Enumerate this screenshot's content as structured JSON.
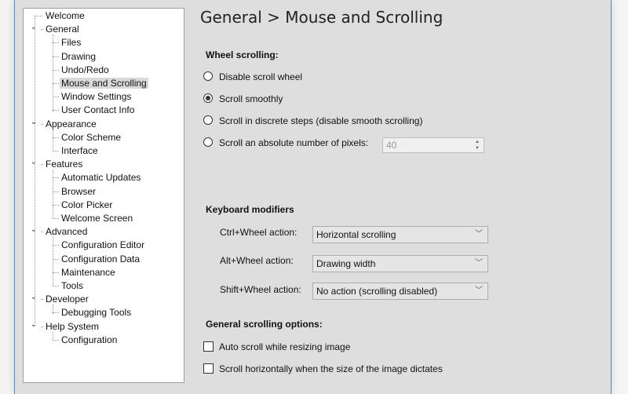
{
  "tree": {
    "items": [
      {
        "label": "Welcome",
        "level": 0,
        "expandable": false
      },
      {
        "label": "General",
        "level": 0,
        "expandable": true
      },
      {
        "label": "Files",
        "level": 1
      },
      {
        "label": "Drawing",
        "level": 1
      },
      {
        "label": "Undo/Redo",
        "level": 1
      },
      {
        "label": "Mouse and Scrolling",
        "level": 1,
        "selected": true
      },
      {
        "label": "Window Settings",
        "level": 1
      },
      {
        "label": "User Contact Info",
        "level": 1
      },
      {
        "label": "Appearance",
        "level": 0,
        "expandable": true
      },
      {
        "label": "Color Scheme",
        "level": 1
      },
      {
        "label": "Interface",
        "level": 1
      },
      {
        "label": "Features",
        "level": 0,
        "expandable": true
      },
      {
        "label": "Automatic Updates",
        "level": 1
      },
      {
        "label": "Browser",
        "level": 1
      },
      {
        "label": "Color Picker",
        "level": 1
      },
      {
        "label": "Welcome Screen",
        "level": 1
      },
      {
        "label": "Advanced",
        "level": 0,
        "expandable": true
      },
      {
        "label": "Configuration Editor",
        "level": 1
      },
      {
        "label": "Configuration Data",
        "level": 1
      },
      {
        "label": "Maintenance",
        "level": 1
      },
      {
        "label": "Tools",
        "level": 1
      },
      {
        "label": "Developer",
        "level": 0,
        "expandable": true
      },
      {
        "label": "Debugging Tools",
        "level": 1
      },
      {
        "label": "Help System",
        "level": 0,
        "expandable": true
      },
      {
        "label": "Configuration",
        "level": 1
      }
    ],
    "chevron_icon": "⌄"
  },
  "main": {
    "title": "General > Mouse and Scrolling",
    "wheel": {
      "heading": "Wheel scrolling:",
      "options": [
        {
          "label": "Disable scroll wheel",
          "checked": false
        },
        {
          "label": "Scroll smoothly",
          "checked": true
        },
        {
          "label": "Scroll in discrete steps (disable smooth scrolling)",
          "checked": false
        },
        {
          "label": "Scroll an absolute number of pixels:",
          "checked": false
        }
      ],
      "pixels_value": "40",
      "spin_up": "▲",
      "spin_down": "▼"
    },
    "keyboard": {
      "heading": "Keyboard modifiers",
      "rows": [
        {
          "label": "Ctrl+Wheel action:",
          "value": "Horizontal scrolling"
        },
        {
          "label": "Alt+Wheel action:",
          "value": "Drawing width"
        },
        {
          "label": "Shift+Wheel action:",
          "value": "No action (scrolling disabled)"
        }
      ],
      "chevron": "﹀"
    },
    "general": {
      "heading": "General scrolling options:",
      "options": [
        {
          "label": "Auto scroll while resizing image",
          "checked": false
        },
        {
          "label": "Scroll horizontally when the size of the image dictates",
          "checked": false
        }
      ]
    }
  }
}
